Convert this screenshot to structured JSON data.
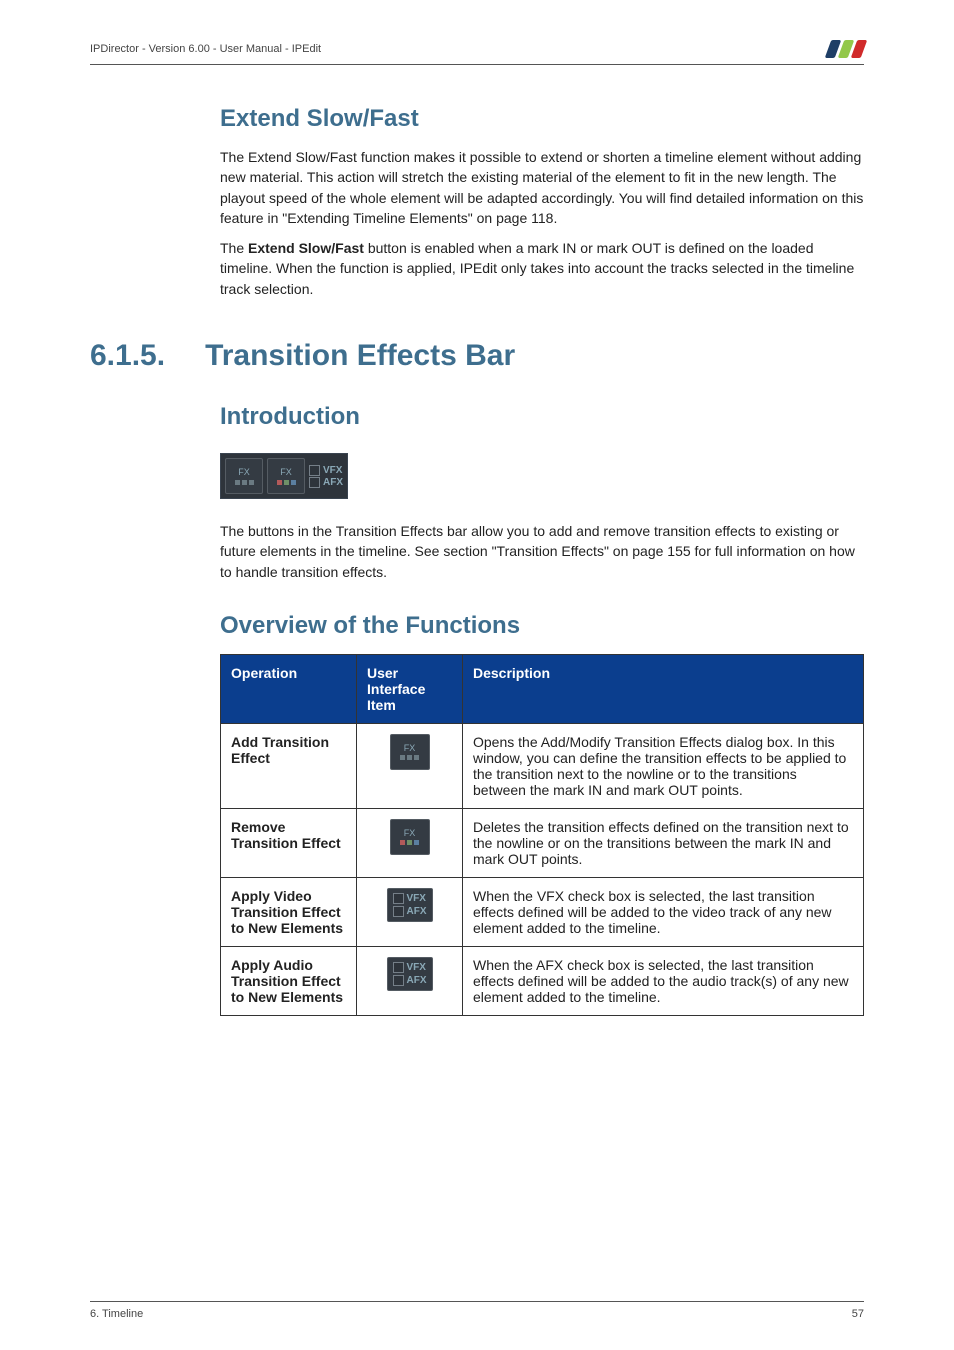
{
  "header": {
    "left": "IPDirector - Version 6.00 - User Manual - IPEdit"
  },
  "section_extend": {
    "title": "Extend Slow/Fast",
    "p1": "The Extend Slow/Fast function makes it possible to extend or shorten a timeline element without adding new material. This action will stretch the existing material of the element to fit in the new length. The playout speed of the whole element will be adapted accordingly. You will find detailed information on this feature in \"Extending Timeline Elements\" on page 118.",
    "p2a": "The ",
    "p2b": "Extend Slow/Fast",
    "p2c": " button is enabled when a mark IN or mark OUT is defined on the loaded timeline. When the function is applied, IPEdit only takes into account the tracks selected in the timeline track selection."
  },
  "section_615": {
    "number": "6.1.5.",
    "title": "Transition Effects Bar"
  },
  "intro": {
    "title": "Introduction",
    "fx_label": "FX",
    "vfx_label": "VFX",
    "afx_label": "AFX",
    "p": "The buttons in the Transition Effects bar allow you to add and remove transition effects to existing or future elements in the timeline. See section \"Transition Effects\" on page 155 for full information on how to handle transition effects."
  },
  "overview": {
    "title": "Overview of the Functions",
    "headers": {
      "op": "Operation",
      "ui": "User Interface Item",
      "desc": "Description"
    },
    "rows": [
      {
        "op": "Add Transition Effect",
        "btn_label": "FX",
        "desc": "Opens the Add/Modify Transition Effects dialog box. In this window, you can define the transition effects to be applied to the transition next to the nowline or to the transitions between the mark IN and mark OUT points."
      },
      {
        "op": "Remove Transition Effect",
        "btn_label": "FX",
        "desc": "Deletes the transition effects defined on the transition next to the nowline or on the transitions between the mark IN and mark OUT points."
      },
      {
        "op": "Apply Video Transition Effect to New Elements",
        "vfx": "VFX",
        "afx": "AFX",
        "desc": "When the VFX check box is selected, the last transition effects defined will be added to the video track of any new element added to the timeline."
      },
      {
        "op": "Apply Audio Transition Effect to New Elements",
        "vfx": "VFX",
        "afx": "AFX",
        "desc": "When the AFX check box is selected, the last transition effects defined will be added to the audio track(s) of any new element added to the timeline."
      }
    ]
  },
  "footer": {
    "left": "6. Timeline",
    "right": "57"
  }
}
